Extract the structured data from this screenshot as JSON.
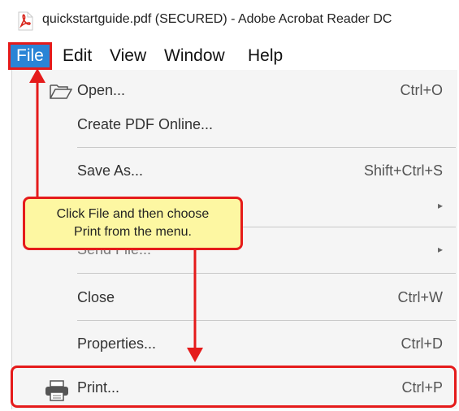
{
  "window": {
    "title": "quickstartguide.pdf (SECURED) - Adobe Acrobat Reader DC"
  },
  "menubar": {
    "items": [
      {
        "label": "File"
      },
      {
        "label": "Edit"
      },
      {
        "label": "View"
      },
      {
        "label": "Window"
      },
      {
        "label": "Help"
      }
    ]
  },
  "file_menu": {
    "items": [
      {
        "label": "Open...",
        "shortcut": "Ctrl+O",
        "icon": "folder-open-icon"
      },
      {
        "label": "Create PDF Online...",
        "shortcut": ""
      },
      {
        "label": "Save As...",
        "shortcut": "Shift+Ctrl+S"
      },
      {
        "label": "",
        "shortcut": "",
        "submenu": true
      },
      {
        "label": "Send File...",
        "shortcut": "",
        "submenu": true
      },
      {
        "label": "Close",
        "shortcut": "Ctrl+W"
      },
      {
        "label": "Properties...",
        "shortcut": "Ctrl+D"
      },
      {
        "label": "Print...",
        "shortcut": "Ctrl+P",
        "icon": "printer-icon"
      }
    ]
  },
  "callout": {
    "line1": "Click File and then choose",
    "line2": "Print from the menu."
  },
  "colors": {
    "highlight_red": "#e51b1b",
    "file_selected_blue": "#2a84d6",
    "callout_yellow": "#fdf7a2"
  }
}
